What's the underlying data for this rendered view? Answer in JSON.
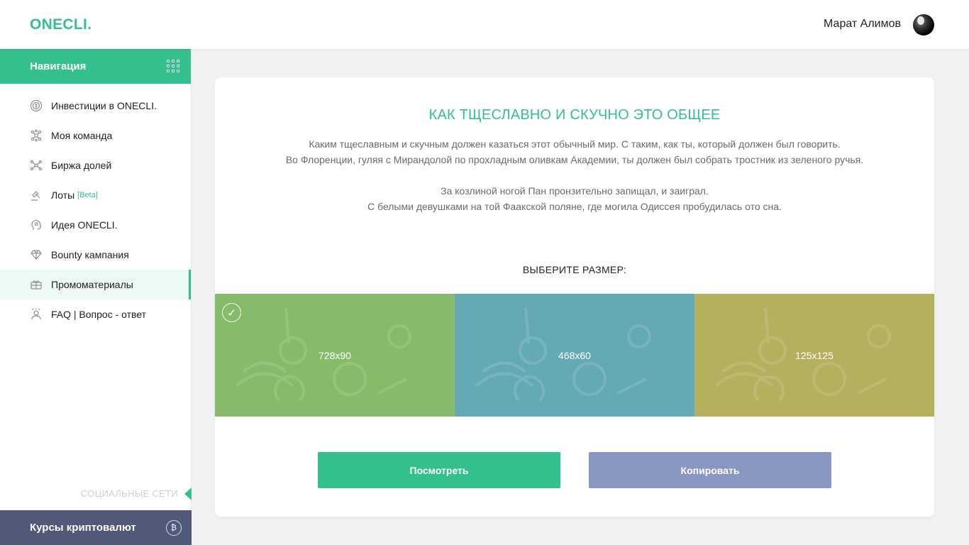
{
  "header": {
    "logo": "ONECLI.",
    "user_name": "Марат Алимов"
  },
  "sidebar": {
    "title": "Навигация",
    "items": [
      {
        "label": "Инвестиции в ONECLI.",
        "icon": "coins-icon"
      },
      {
        "label": "Моя команда",
        "icon": "team-icon"
      },
      {
        "label": "Биржа долей",
        "icon": "exchange-icon"
      },
      {
        "label": "Лоты",
        "badge": "[Beta]",
        "icon": "auction-icon"
      },
      {
        "label": "Идея ONECLI.",
        "icon": "idea-icon"
      },
      {
        "label": "Bounty кампания",
        "icon": "diamond-icon"
      },
      {
        "label": "Промоматериалы",
        "icon": "gift-icon",
        "active": true
      },
      {
        "label": "FAQ | Вопрос - ответ",
        "icon": "faq-icon"
      }
    ],
    "social_label": "СОЦИАЛЬНЫЕ СЕТИ",
    "crypto_label": "Курсы криптовалют"
  },
  "main": {
    "title": "КАК ТЩЕСЛАВНО И СКУЧНО ЭТО ОБЩЕЕ",
    "paragraph1_line1": "Каким тщеславным и скучным должен казаться этот обычный мир. С таким, как ты, который должен был говорить.",
    "paragraph1_line2": "Во Флоренции, гуляя с Мирандолой по прохладным оливкам Академии, ты должен был собрать тростник из зеленого ручья.",
    "paragraph2_line1": "За козлиной ногой Пан пронзительно запищал, и заиграл.",
    "paragraph2_line2": "С белыми девушками на той Фаакской поляне, где могила Одиссея пробудилась ото сна.",
    "size_label": "ВЫБЕРИТЕ РАЗМЕР:",
    "banners": [
      {
        "size": "728x90",
        "color": "#86bb6a",
        "selected": true
      },
      {
        "size": "468x60",
        "color": "#64aab5",
        "selected": false
      },
      {
        "size": "125x125",
        "color": "#b5b05e",
        "selected": false
      }
    ],
    "view_button": "Посмотреть",
    "copy_button": "Копировать"
  },
  "colors": {
    "accent": "#34c08c",
    "copy_button": "#8a97c0",
    "crypto_bar": "#50597a"
  }
}
